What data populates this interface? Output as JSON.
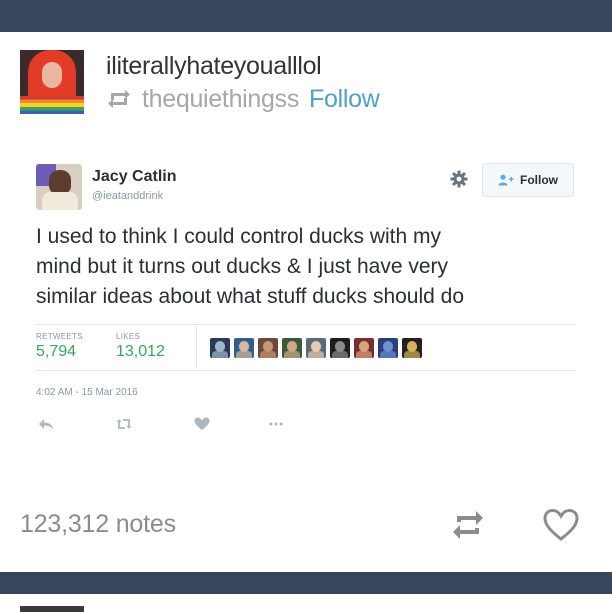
{
  "post": {
    "username": "iliterallyhateyoualllol",
    "reblog_source": "thequiethingss",
    "follow_label": "Follow",
    "notes": "123,312 notes"
  },
  "tweet": {
    "name": "Jacy Catlin",
    "handle": "@ieatanddrink",
    "follow_label": "Follow",
    "text_lines": [
      "I used to think I could control ducks with my",
      "mind but it turns out ducks & I just have very",
      "similar ideas about what stuff ducks should do"
    ],
    "retweets_label": "RETWEETS",
    "retweets_value": "5,794",
    "likes_label": "LIKES",
    "likes_value": "13,012",
    "timestamp": "4:02 AM - 15 Mar 2016",
    "liker_avatars": [
      {
        "color": "#2b3a55",
        "face": "#9fb6cf"
      },
      {
        "color": "#2f5f8f",
        "face": "#d9b99a"
      },
      {
        "color": "#6b4a3a",
        "face": "#c99678"
      },
      {
        "color": "#3a5a3a",
        "face": "#d1a989"
      },
      {
        "color": "#5c6a78",
        "face": "#e4cdb3"
      },
      {
        "color": "#1d1d1d",
        "face": "#8a8a8a"
      },
      {
        "color": "#7a2f2f",
        "face": "#d8a37f"
      },
      {
        "color": "#2a3f7a",
        "face": "#6f8fd3"
      },
      {
        "color": "#222222",
        "face": "#d8b25a"
      }
    ]
  },
  "colors": {
    "bar": "#36465d",
    "follow_blue": "#529ecc",
    "stat_green": "#3aa55a"
  }
}
